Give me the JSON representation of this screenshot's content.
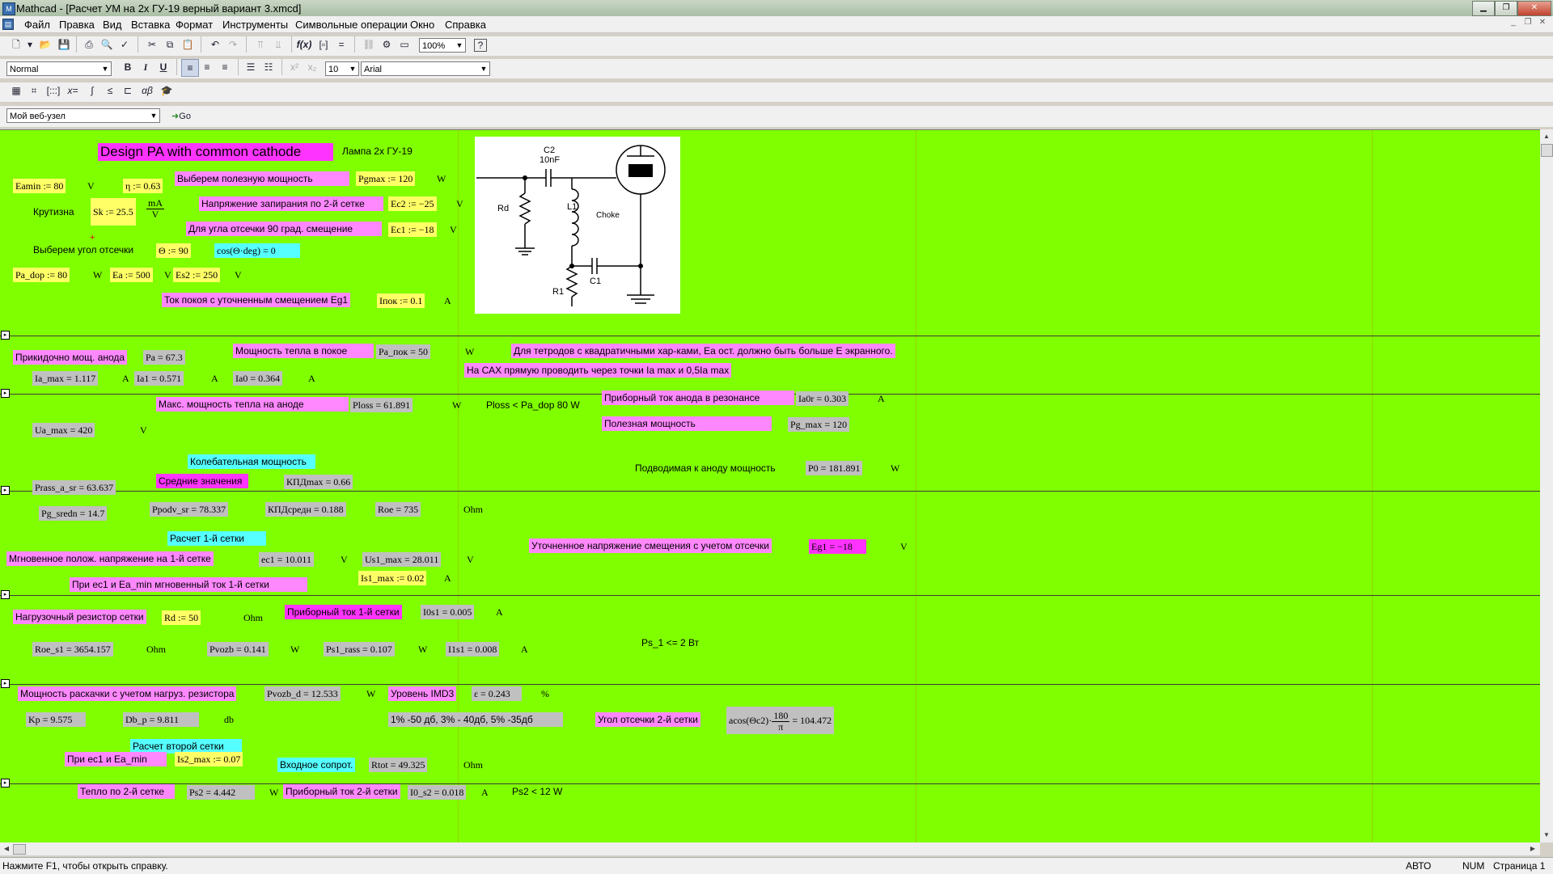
{
  "window": {
    "title": "Mathcad - [Расчет УМ на 2х ГУ-19  верный вариант 3.xmcd]"
  },
  "menu": [
    "Файл",
    "Правка",
    "Вид",
    "Вставка",
    "Формат",
    "Инструменты",
    "Символьные операции",
    "Окно",
    "Справка"
  ],
  "toolbar": {
    "zoom": "100%",
    "style": "Normal",
    "font_size": "10",
    "font": "Arial",
    "web_location": "Мой веб-узел",
    "go_label": "Go"
  },
  "sheet": {
    "title": "Design PA with common cathode",
    "lamp": "Лампа 2х ГУ-19",
    "eamin": "Eamin := 80",
    "u_v": "V",
    "eta": "η := 0.63",
    "choose_power": "Выберем полезную мощность",
    "pgmax": "Pgmax := 120",
    "u_w": "W",
    "steepness": "Крутизна",
    "sk": "Sk := 25.5",
    "sk_num": "mA",
    "sk_den": "V",
    "cutoff_v": "Напряжение запирания по 2-й сетке",
    "ec2": "Ec2 := −25",
    "bias90": "Для угла отсечки 90 град. смещение",
    "ec1": "Ec1 := −18",
    "choose_angle": "Выберем угол отсечки",
    "theta": "Θ := 90",
    "cos": "cos(Θ·deg) = 0",
    "padop": "Pa_dop := 80",
    "ea": "Ea := 500",
    "es2": "Es2 := 250",
    "quiescent": "Ток покоя с уточненным смещением Eg1",
    "ipok": "Iпок := 0.1",
    "u_a": "A",
    "approx_power": "Прикидочно мощ. анода",
    "pa": "Pa = 67.3",
    "rest_power": "Мощность тепла в покое",
    "papok": "Pa_пок = 50",
    "tetrode_note": "Для тетродов с квадратичными хар-ками, Ea ост. должно быть больше E экранного.",
    "ia_max": "Ia_max = 1.117",
    "ia1": "Ia1 = 0.571",
    "ia0": "Ia0 = 0.364",
    "cax_note": "На САХ прямую проводить через точки Ia max  и 0,5Ia max",
    "max_heat": "Макс. мощность тепла на аноде",
    "ploss": "Ploss = 61.891",
    "ploss_cmp": "Ploss < Pa_dop 80 W",
    "res_current": "Приборный ток анода  в резонансе",
    "ia0r": "Ia0r = 0.303",
    "ua_max": "Ua_max = 420",
    "useful_power": "Полезная мощность",
    "pg_max": "Pg_max = 120",
    "osc_power": "Колебательная мощность",
    "supplied": "Подводимая к аноду мощность",
    "p0": "P0 = 181.891",
    "prass": "Prass_a_sr = 63.637",
    "avg_values": "Средние значения",
    "kpd_max": "КПДmax = 0.66",
    "pg_sredn": "Pg_sredn = 14.7",
    "ppodv": "Ppodv_sr = 78.337",
    "kpd_sr": "КПДсредн = 0.188",
    "roe": "Roe = 735",
    "u_ohm": "Ohm",
    "grid1_calc": "Расчет 1-й сетки",
    "refined_bias": "Уточненное напряжение смещения с учетом отсечки",
    "eg1": "Eg1 = −18",
    "inst_voltage": "Мгновенное полож. напряжение на 1-й сетке",
    "ec1v": "ec1 = 10.011",
    "us1": "Us1_max = 28.011",
    "inst_current": "При ec1  и Ea_min мгновенный ток 1-й сетки",
    "is1": "Is1_max := 0.02",
    "load_res": "Нагрузочный резистор сетки",
    "rd": "Rd := 50",
    "grid1_current": "Приборный ток 1-й сетки",
    "i0s1": "I0s1 = 0.005",
    "roe_s1": "Roe_s1 = 3654.157",
    "pvozb": "Pvozb = 0.141",
    "ps1": "Ps1_rass = 0.107",
    "i1s1": "I1s1 = 0.008",
    "ps1_limit": "Ps_1 <= 2 Вт",
    "drive_power": "Мощность раскачки с учетом нагруз. резистора",
    "pvozb_d": "Pvozb_d = 12.533",
    "imd3": "Уровень IMD3",
    "eps": "ε = 0.243",
    "u_pct": "%",
    "kp": "Kp = 9.575",
    "db_p": "Db_p = 9.811",
    "u_db": "db",
    "imd_note": "1% -50 дб, 3% - 40дб, 5% -35дб",
    "grid2_angle": "Угол отсечки 2-й сетки",
    "acos_left": "acos(Θc2)·",
    "acos_num": "180",
    "acos_den": "π",
    "acos_right": "= 104.472",
    "grid2_calc": "Расчет второй сетки",
    "at_ec1": "При ec1 и Ea_min",
    "is2": "Is2_max := 0.07",
    "input_res": "Входное сопрот.",
    "rtot": "Rtot = 49.325",
    "grid2_heat": "Тепло по 2-й сетке",
    "ps2": "Ps2 = 4.442",
    "grid2_current": "Приборный ток 2-й сетки",
    "i0s2": "I0_s2 = 0.018",
    "ps2_cmp": "Ps2 < 12 W"
  },
  "schematic": {
    "c2": "C2",
    "c2v": "10nF",
    "rd": "Rd",
    "l1": "L1",
    "choke": "Choke",
    "r1": "R1",
    "c1": "C1"
  },
  "status": {
    "hint": "Нажмите F1, чтобы открыть справку.",
    "mode": "АВТО",
    "num": "NUM",
    "page": "Страница 1"
  }
}
